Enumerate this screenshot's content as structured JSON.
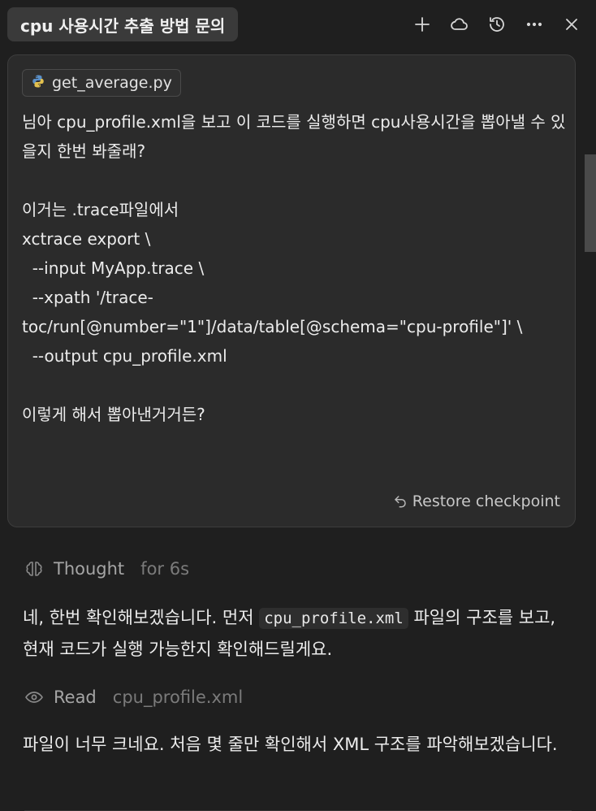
{
  "header": {
    "title": "cpu 사용시간 추출 방법 문의",
    "actions": [
      {
        "icon": "plus-icon"
      },
      {
        "icon": "cloud-icon"
      },
      {
        "icon": "history-icon"
      },
      {
        "icon": "more-icon"
      },
      {
        "icon": "close-icon"
      }
    ]
  },
  "user_message": {
    "attachment": {
      "icon": "python-icon",
      "name": "get_average.py"
    },
    "text": "님아 cpu_profile.xml을 보고 이 코드를 실행하면 cpu사용시간을 뽑아낼 수 있을지 한번 봐줄래?\n\n이거는 .trace파일에서\nxctrace export \\\n  --input MyApp.trace \\\n  --xpath '/trace-toc/run[@number=\"1\"]/data/table[@schema=\"cpu-profile\"]' \\\n  --output cpu_profile.xml\n\n이렇게 해서 뽑아낸거거든?",
    "restore_label": "Restore checkpoint"
  },
  "assistant": {
    "thought": {
      "label": "Thought",
      "duration": "for 6s"
    },
    "p1": {
      "before": "네, 한번 확인해보겠습니다. 먼저 ",
      "code": "cpu_profile.xml",
      "after": " 파일의 구조를 보고, 현재 코드가 실행 가능한지 확인해드릴게요."
    },
    "read": {
      "label": "Read",
      "file": "cpu_profile.xml"
    },
    "p2": "파일이 너무 크네요. 처음 몇 줄만 확인해서 XML 구조를 파악해보겠습니다."
  }
}
